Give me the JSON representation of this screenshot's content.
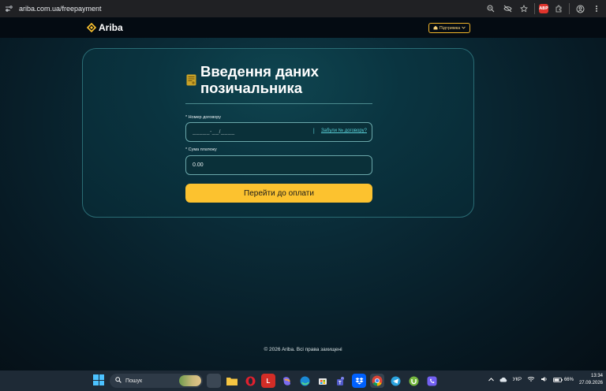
{
  "browser": {
    "url": "ariba.com.ua/freepayment",
    "icons": [
      "zoom-icon",
      "eye-off-icon",
      "star-icon",
      "adblock-plus-icon",
      "extensions-icon",
      "profile-icon",
      "menu-icon"
    ],
    "abp_label": "ABP"
  },
  "header": {
    "logo_text": "Ariba",
    "support_label": "Підтримка",
    "brand_color": "#fcc22f"
  },
  "form": {
    "title": "Введення даних позичальника",
    "contract_label": "* Номер договору",
    "contract_placeholder": "_____-__/____",
    "forgot_link": "Забули № договору?",
    "sum_label": "* Сума платежу",
    "sum_value": "0.00",
    "submit_label": "Перейти до оплати"
  },
  "footer": {
    "copyright": "© 2026 Ariba. Всі права захищені"
  },
  "taskbar": {
    "search_placeholder": "Пошук",
    "language": "УКР",
    "battery": "66%",
    "time": "13:34",
    "date": "27.09.2026",
    "apps": [
      "task-view",
      "file-explorer",
      "opera",
      "lastpass",
      "copilot",
      "edge",
      "microsoft-store",
      "teams",
      "dropbox",
      "chrome",
      "telegram",
      "utorrent",
      "viber"
    ]
  }
}
